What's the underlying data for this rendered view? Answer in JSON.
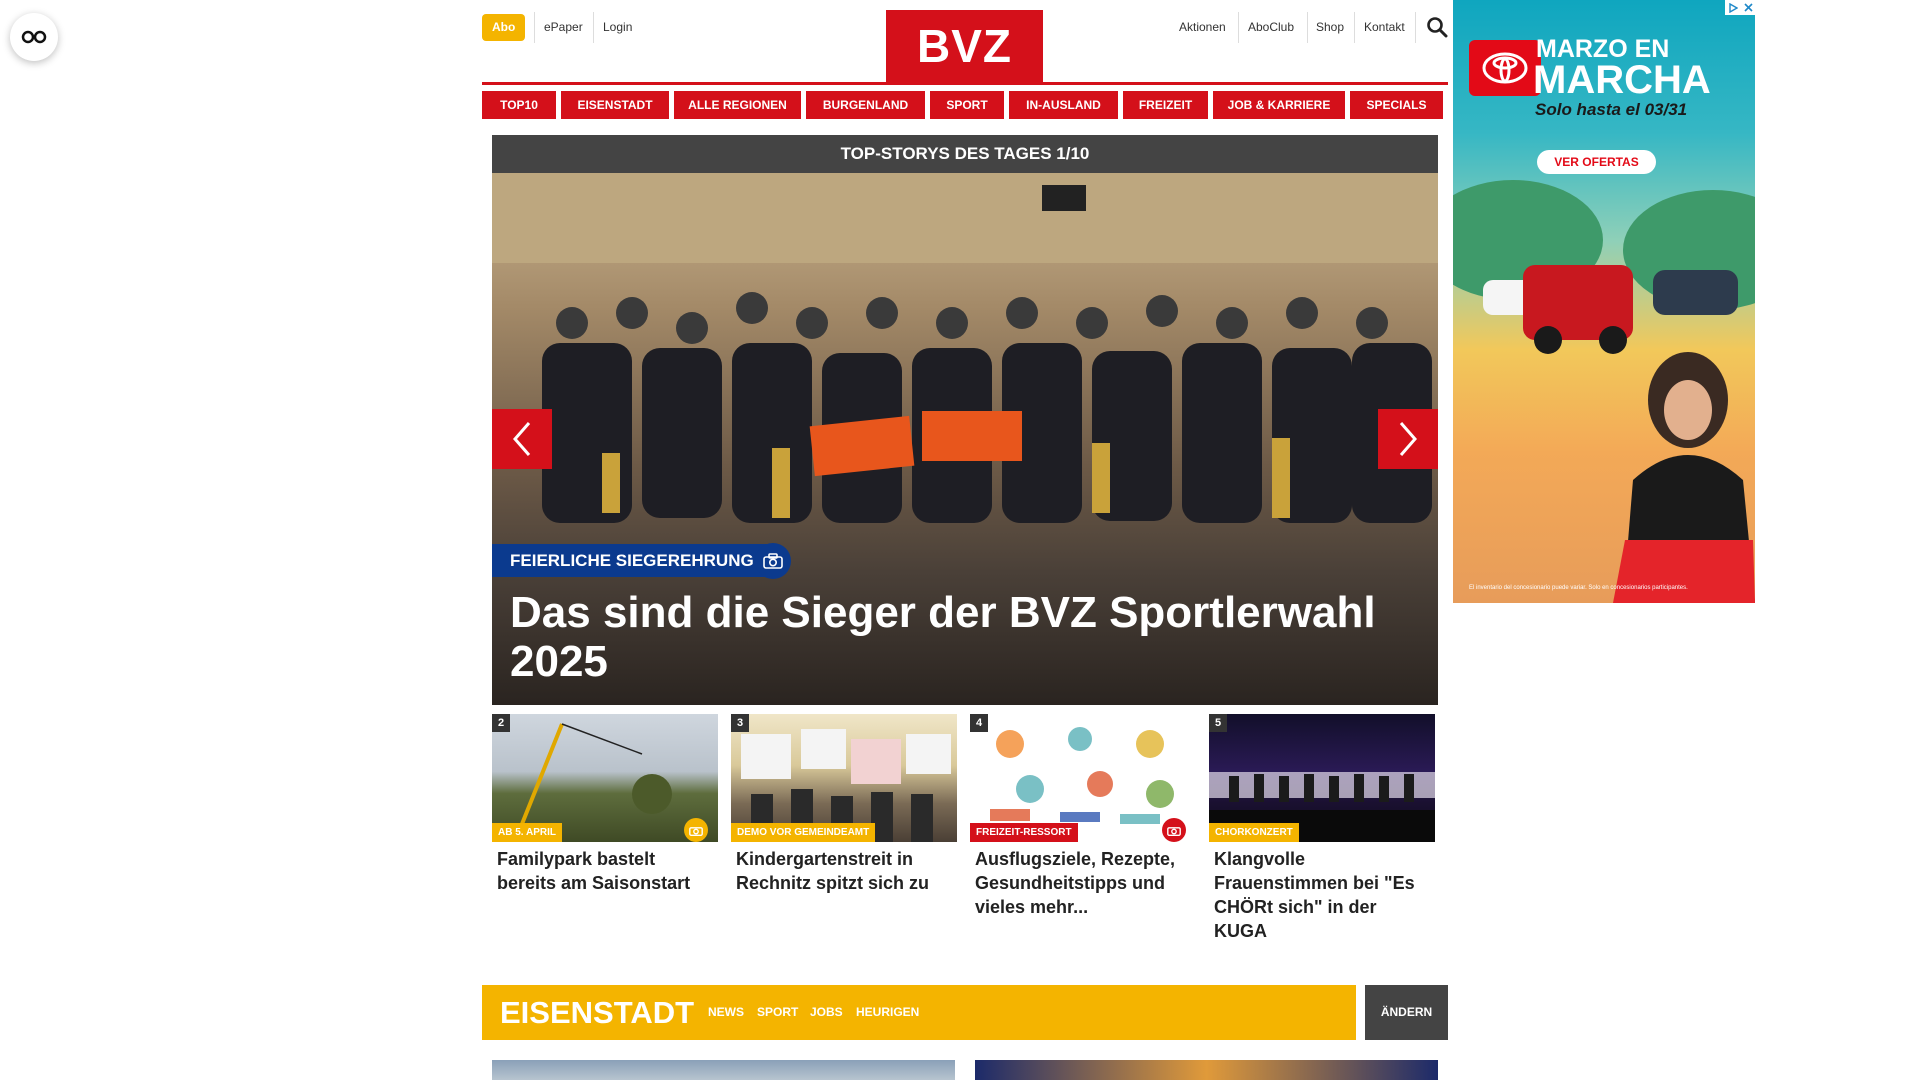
{
  "accessibility": {
    "icon": "glasses-icon"
  },
  "topbar": {
    "abo": "Abo",
    "epaper": "ePaper",
    "login": "Login",
    "logo": "BVZ",
    "aktionen": "Aktionen",
    "aboclub": "AboClub",
    "shop": "Shop",
    "kontakt": "Kontakt",
    "search_icon": "search-icon"
  },
  "nav": {
    "items": [
      "Top10",
      "Eisenstadt",
      "Alle Regionen",
      "Burgenland",
      "Sport",
      "In-Ausland",
      "Freizeit",
      "Job & Karriere",
      "Specials"
    ]
  },
  "hero": {
    "header": "TOP-STORYS DES TAGES 1/10",
    "kicker": "FEIERLICHE SIEGEREHRUNG",
    "title": "Das sind die Sieger der BVZ Sportlerwahl 2025",
    "colors": {
      "kicker_bg": "#0b3a8e",
      "arrow_bg": "#d4101a"
    }
  },
  "stories": [
    {
      "num": "2",
      "tag": "AB 5. APRIL",
      "tag_color": "#f4b400",
      "title": "Familypark bastelt bereits am Saisonstart",
      "has_camera": true
    },
    {
      "num": "3",
      "tag": "DEMO VOR GEMEINDEAMT",
      "tag_color": "#f4b400",
      "title": "Kindergartenstreit in Rechnitz spitzt sich zu",
      "has_camera": false
    },
    {
      "num": "4",
      "tag": "FREIZEIT-RESSORT",
      "tag_color": "#d4101a",
      "title": "Ausflugsziele, Rezepte, Gesundheitstipps und vieles mehr...",
      "has_camera": true
    },
    {
      "num": "5",
      "tag": "CHORKONZERT",
      "tag_color": "#f4b400",
      "title": "Klangvolle Frauenstimmen bei \"Es CHÖRt sich\" in der KUGA",
      "has_camera": false
    }
  ],
  "section": {
    "title": "EISENSTADT",
    "links": [
      "NEWS",
      "SPORT",
      "JOBS",
      "HEURIGEN"
    ],
    "change": "ÄNDERN"
  },
  "ad": {
    "line1": "MARZO EN",
    "line2": "MARCHA",
    "sub": "Solo hasta el 03/31",
    "cta": "VER OFERTAS",
    "fine": "El inventario del concesionario puede variar. Solo en concesionarios participantes."
  },
  "colors": {
    "brand_red": "#d4101a",
    "brand_yellow": "#f4b400",
    "dark": "#444444"
  }
}
